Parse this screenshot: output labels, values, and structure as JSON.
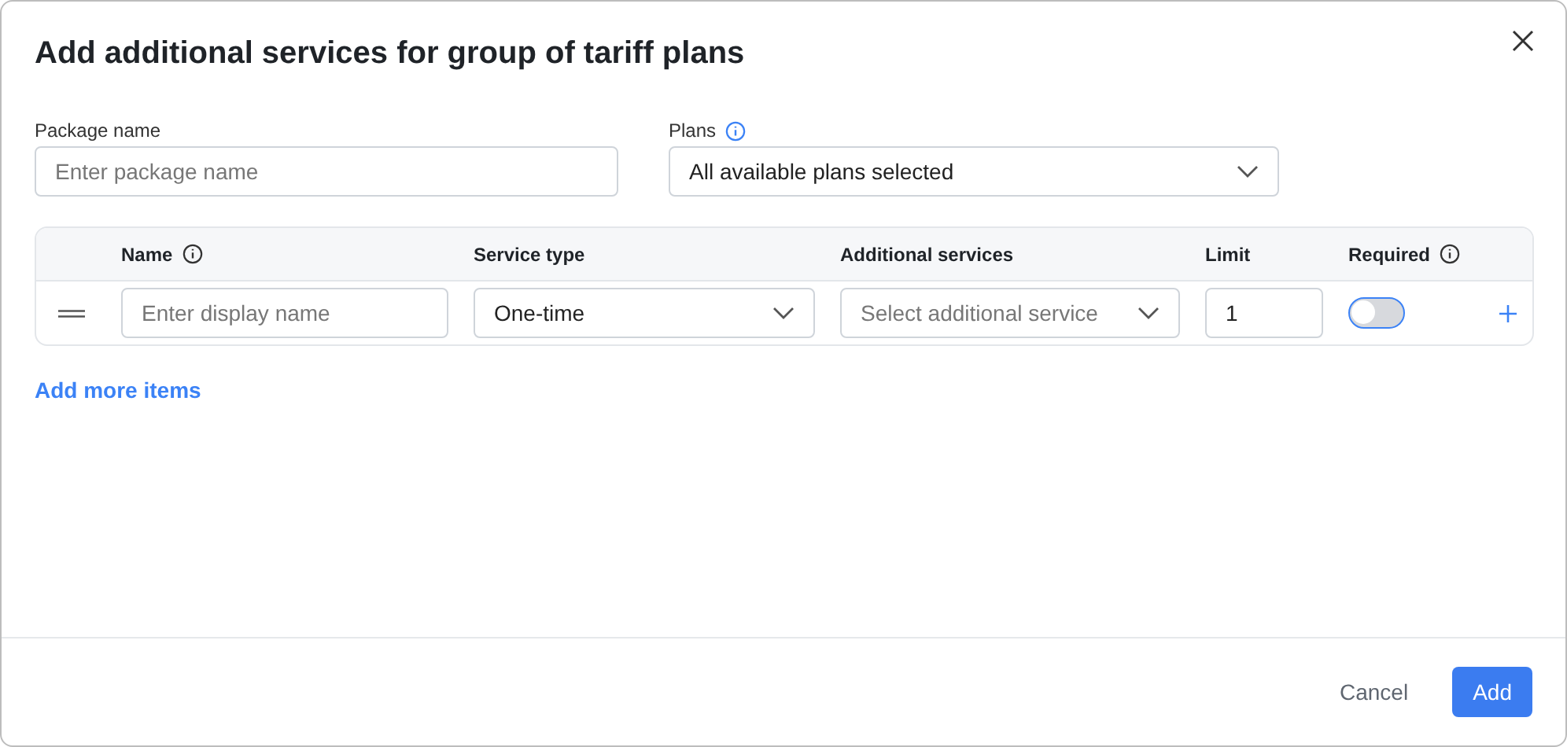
{
  "dialog": {
    "title": "Add additional services for group of tariff plans"
  },
  "package_name": {
    "label": "Package name",
    "placeholder": "Enter package name"
  },
  "plans": {
    "label": "Plans",
    "value": "All available plans selected"
  },
  "table": {
    "columns": [
      {
        "label": "Name",
        "info": true
      },
      {
        "label": "Service type",
        "info": false
      },
      {
        "label": "Additional services",
        "info": false
      },
      {
        "label": "Limit",
        "info": false
      },
      {
        "label": "Required",
        "info": true
      }
    ],
    "rows": [
      {
        "name_placeholder": "Enter display name",
        "service_type": "One-time",
        "additional_placeholder": "Select additional service",
        "limit": "1",
        "required": false
      }
    ]
  },
  "add_more": "Add more items",
  "buttons": {
    "cancel": "Cancel",
    "add": "Add"
  }
}
